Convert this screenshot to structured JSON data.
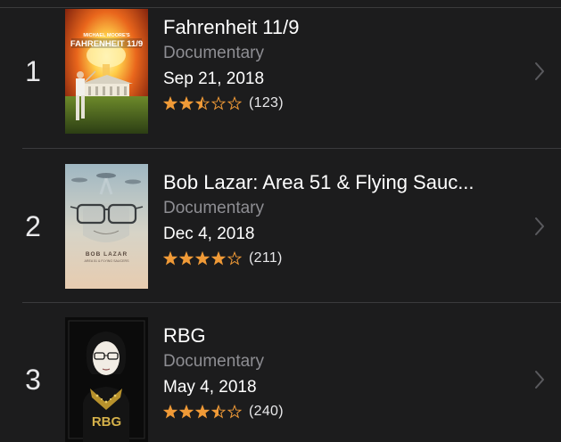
{
  "colors": {
    "background": "#1c1c1d",
    "divider": "#3a3a3c",
    "title": "#ffffff",
    "genre": "#8e8e93",
    "star": "#f09a37",
    "chevron": "#5a5a5e"
  },
  "items": [
    {
      "rank": "1",
      "title": "Fahrenheit 11/9",
      "genre": "Documentary",
      "date": "Sep 21, 2018",
      "rating": 2.5,
      "rating_count": "(123)",
      "poster": {
        "header": "MICHAEL MOORE'S",
        "title": "FAHRENHEIT 11/9"
      }
    },
    {
      "rank": "2",
      "title": "Bob Lazar: Area 51 & Flying Sauc...",
      "genre": "Documentary",
      "date": "Dec 4, 2018",
      "rating": 4,
      "rating_count": "(211)",
      "poster": {
        "title": "BOB LAZAR",
        "subtitle": "AREA 51 & FLYING SAUCERS"
      }
    },
    {
      "rank": "3",
      "title": "RBG",
      "genre": "Documentary",
      "date": "May 4, 2018",
      "rating": 3.5,
      "rating_count": "(240)",
      "poster": {
        "title": "RBG"
      }
    }
  ]
}
